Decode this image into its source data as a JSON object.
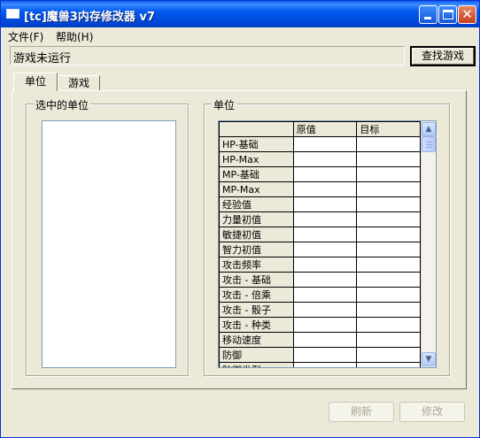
{
  "window": {
    "title": "[tc]魔兽3内存修改器 v7"
  },
  "menu": [
    {
      "label": "文件(F)"
    },
    {
      "label": "帮助(H)"
    }
  ],
  "status": {
    "text": "游戏未运行"
  },
  "find_button": {
    "label": "查找游戏"
  },
  "tabs": [
    {
      "label": "单位",
      "active": true
    },
    {
      "label": "游戏",
      "active": false
    }
  ],
  "selected_units": {
    "title": "选中的单位"
  },
  "units_grid": {
    "title": "单位",
    "columns": [
      "",
      "原值",
      "目标"
    ],
    "rows": [
      "HP-基础",
      "HP-Max",
      "MP-基础",
      "MP-Max",
      "经验值",
      "力量初值",
      "敏捷初值",
      "智力初值",
      "攻击频率",
      "攻击 - 基础",
      "攻击 - 倍乘",
      "攻击 - 骰子",
      "攻击 - 种类",
      "移动速度",
      "防御",
      "防御类型"
    ]
  },
  "buttons": {
    "refresh": "刷新",
    "modify": "修改"
  },
  "colors": {
    "title_bar": "#0058ee",
    "face": "#ece9d8",
    "close": "#c4401c"
  },
  "icons": {
    "scroll_up": "▲",
    "scroll_down": "▼",
    "close": "✕"
  }
}
